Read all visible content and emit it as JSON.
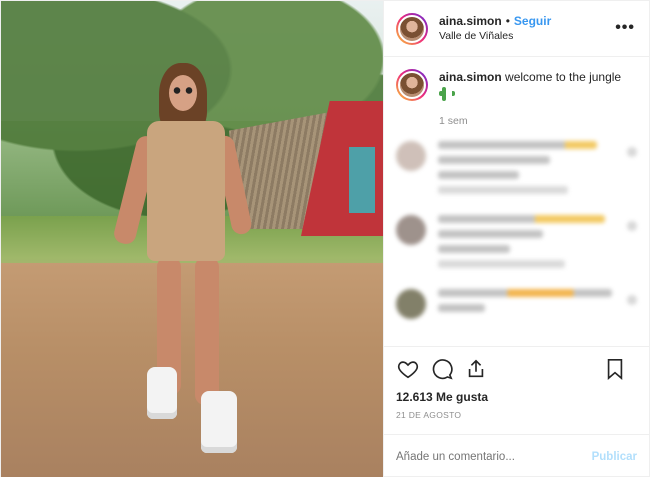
{
  "header": {
    "username": "aina.simon",
    "separator": "•",
    "follow_label": "Seguir",
    "location": "Valle de Viñales",
    "more_label": "•••"
  },
  "caption": {
    "username": "aina.simon",
    "text": "welcome to the jungle",
    "emoji_icon": "cactus-emoji",
    "time": "1 sem"
  },
  "blurred_comments_count": 3,
  "actions": {
    "icons": [
      "heart-icon",
      "comment-icon",
      "share-icon",
      "bookmark-icon"
    ]
  },
  "likes": "12.613 Me gusta",
  "date": "21 DE AGOSTO",
  "add_comment": {
    "placeholder": "Añade un comentario...",
    "publish_label": "Publicar"
  },
  "colors": {
    "accent": "#3897f0",
    "publish_disabled": "#b2dffc",
    "muted": "#8e8e8e",
    "text": "#262626"
  }
}
